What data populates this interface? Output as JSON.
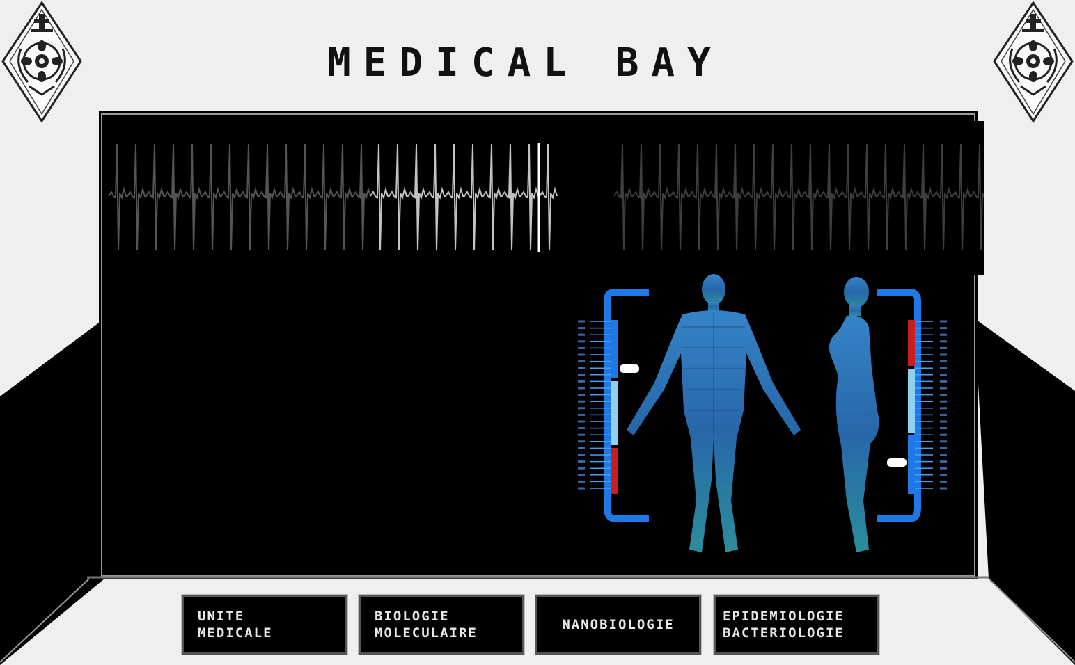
{
  "header": {
    "title": "MEDICAL BAY"
  },
  "emblem": {
    "icon": "crest-diamond-icon",
    "color": "#1a1a1a"
  },
  "monitor": {
    "trace_color": "#cfcfcf",
    "background": "#000000"
  },
  "body_scan": {
    "accent": "#1e78e6",
    "high_color": "#c81e1e",
    "normal_color": "#8fd0f0",
    "front_marker_level": 0.28,
    "side_marker_level": 0.82
  },
  "nav": {
    "buttons": [
      {
        "label": "UNITE\nMEDICALE"
      },
      {
        "label": "BIOLOGIE\nMOLECULAIRE"
      },
      {
        "label": "NANOBIOLOGIE"
      },
      {
        "label": "EPIDEMIOLOGIE\nBACTERIOLOGIE"
      }
    ]
  }
}
